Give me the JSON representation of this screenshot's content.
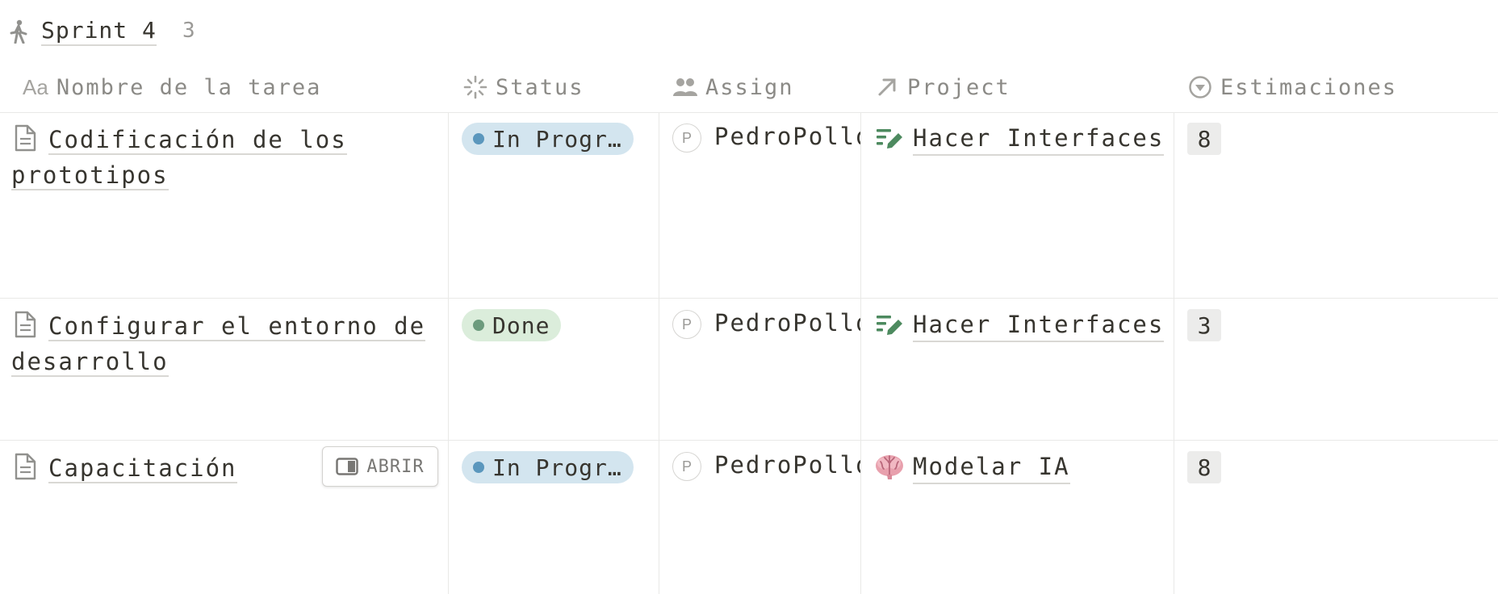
{
  "group": {
    "title": "Sprint 4",
    "count": "3"
  },
  "columns": {
    "name_prefix": "Aa",
    "name": "Nombre de la tarea",
    "status": "Status",
    "assign": "Assign",
    "project": "Project",
    "estimate": "Estimaciones"
  },
  "rows": [
    {
      "name": "Codificación de los prototipos",
      "status": "In Progr…",
      "status_color": "#d3e5ef",
      "status_dot": "#5b97bd",
      "assignee_initial": "P",
      "assignee": "PedroPollo",
      "project": "Hacer Interfaces",
      "project_icon": "edit-list-icon",
      "estimate": "8"
    },
    {
      "name": "Configurar el entorno de desarrollo",
      "status": "Done",
      "status_color": "#dbeddb",
      "status_dot": "#6c9b7d",
      "assignee_initial": "P",
      "assignee": "PedroPollo",
      "project": "Hacer Interfaces",
      "project_icon": "edit-list-icon",
      "estimate": "3"
    },
    {
      "name": "Capacitación",
      "status": "In Progr…",
      "status_color": "#d3e5ef",
      "status_dot": "#5b97bd",
      "assignee_initial": "P",
      "assignee": "PedroPollo",
      "project": "Modelar IA",
      "project_icon": "brain-icon",
      "estimate": "8",
      "open_label": "ABRIR"
    }
  ]
}
